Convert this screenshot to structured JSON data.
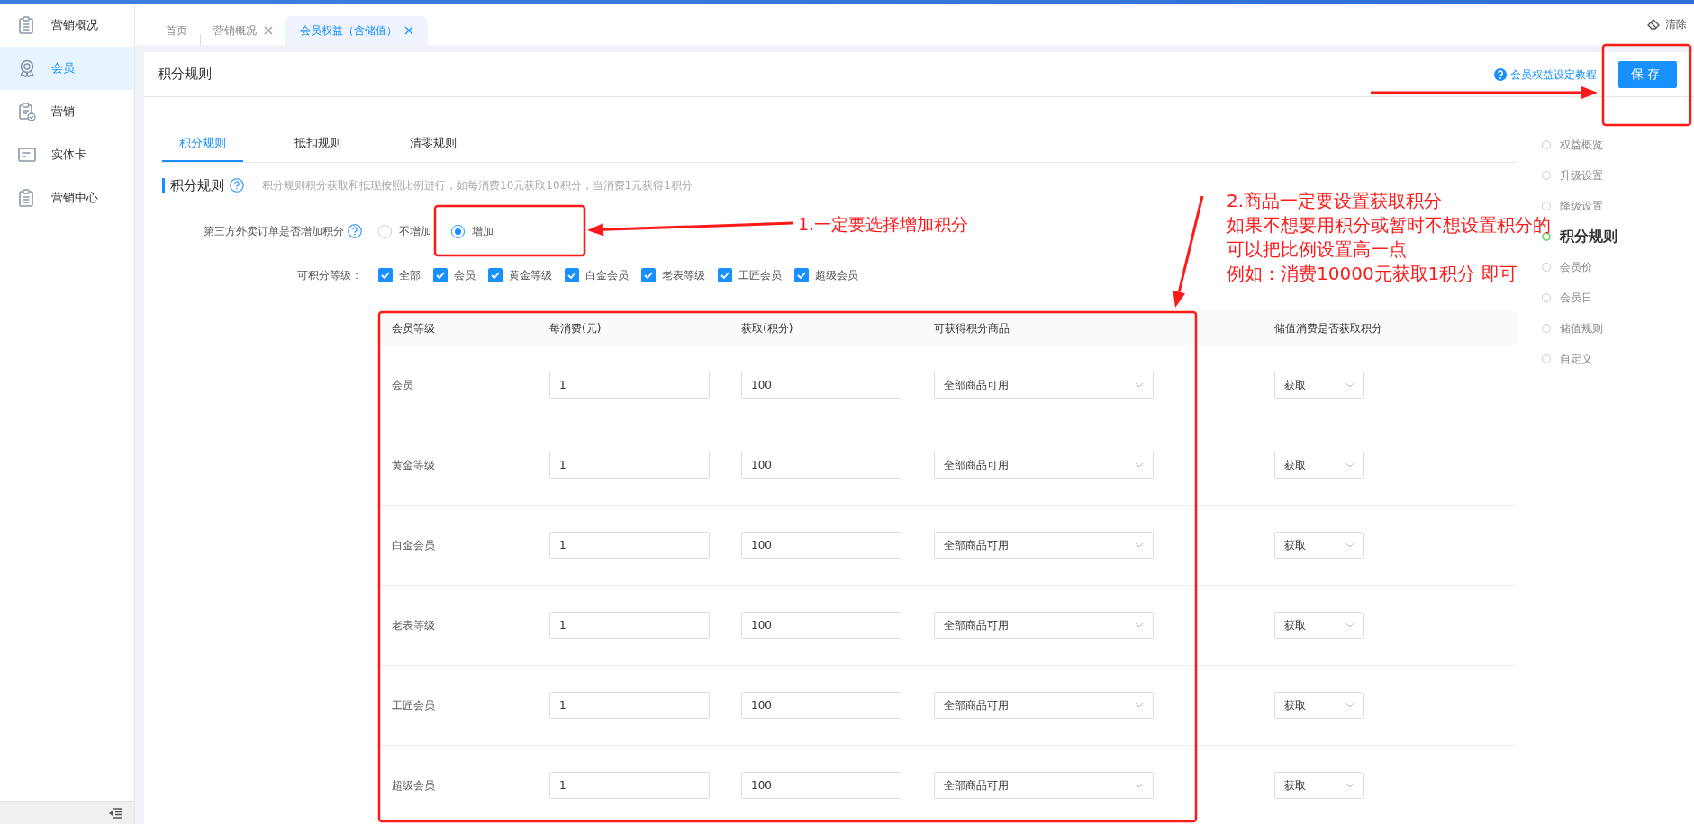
{
  "sidebar": {
    "items": [
      {
        "label": "营销概况",
        "selected": false,
        "kind": "clipboard"
      },
      {
        "label": "会员",
        "selected": true,
        "kind": "award"
      },
      {
        "label": "营销",
        "selected": false,
        "kind": "clipcheck"
      },
      {
        "label": "实体卡",
        "selected": false,
        "kind": "card"
      },
      {
        "label": "营销中心",
        "selected": false,
        "kind": "clipboard"
      }
    ]
  },
  "tabs": [
    {
      "label": "首页",
      "selected": false,
      "closable": false
    },
    {
      "label": "营销概况",
      "selected": false,
      "closable": true
    },
    {
      "label": "会员权益（含储值）",
      "selected": true,
      "closable": true
    }
  ],
  "clear_button": "清除",
  "page": {
    "title": "积分规则",
    "help_link": "会员权益设定教程",
    "save_button": "保存"
  },
  "sub_tabs": [
    {
      "label": "积分规则",
      "selected": true
    },
    {
      "label": "抵扣规则",
      "selected": false
    },
    {
      "label": "清零规则",
      "selected": false
    }
  ],
  "section": {
    "title": "积分规则",
    "description": "积分规则积分获取和抵现按照比例进行，如每消费10元获取10积分，当消费1元获得1积分"
  },
  "third_party": {
    "label": "第三方外卖订单是否增加积分",
    "options": [
      {
        "label": "不增加",
        "selected": false
      },
      {
        "label": "增加",
        "selected": true
      }
    ]
  },
  "levels": {
    "label": "可积分等级：",
    "options": [
      {
        "label": "全部",
        "checked": true
      },
      {
        "label": "会员",
        "checked": true
      },
      {
        "label": "黄金等级",
        "checked": true
      },
      {
        "label": "白金会员",
        "checked": true
      },
      {
        "label": "老表等级",
        "checked": true
      },
      {
        "label": "工匠会员",
        "checked": true
      },
      {
        "label": "超级会员",
        "checked": true
      }
    ]
  },
  "table": {
    "columns": [
      "会员等级",
      "每消费(元)",
      "获取(积分)",
      "可获得积分商品",
      "储值消费是否获取积分"
    ],
    "rows": [
      {
        "level": "会员",
        "spend": "1",
        "points": "100",
        "goods": "全部商品可用",
        "stored_value": "获取"
      },
      {
        "level": "黄金等级",
        "spend": "1",
        "points": "100",
        "goods": "全部商品可用",
        "stored_value": "获取"
      },
      {
        "level": "白金会员",
        "spend": "1",
        "points": "100",
        "goods": "全部商品可用",
        "stored_value": "获取"
      },
      {
        "level": "老表等级",
        "spend": "1",
        "points": "100",
        "goods": "全部商品可用",
        "stored_value": "获取"
      },
      {
        "level": "工匠会员",
        "spend": "1",
        "points": "100",
        "goods": "全部商品可用",
        "stored_value": "获取"
      },
      {
        "level": "超级会员",
        "spend": "1",
        "points": "100",
        "goods": "全部商品可用",
        "stored_value": "获取"
      }
    ]
  },
  "anchor_nav": [
    {
      "label": "权益概览",
      "selected": false
    },
    {
      "label": "升级设置",
      "selected": false
    },
    {
      "label": "降级设置",
      "selected": false
    },
    {
      "label": "积分规则",
      "selected": true
    },
    {
      "label": "会员价",
      "selected": false
    },
    {
      "label": "会员日",
      "selected": false
    },
    {
      "label": "储值规则",
      "selected": false
    },
    {
      "label": "自定义",
      "selected": false
    }
  ],
  "annotations": {
    "note_1": "1.一定要选择增加积分",
    "note_2": [
      "2.商品一定要设置获取积分",
      "如果不想要用积分或暂时不想设置积分的",
      "可以把比例设置高一点",
      "例如：消费10000元获取1积分 即可"
    ]
  }
}
